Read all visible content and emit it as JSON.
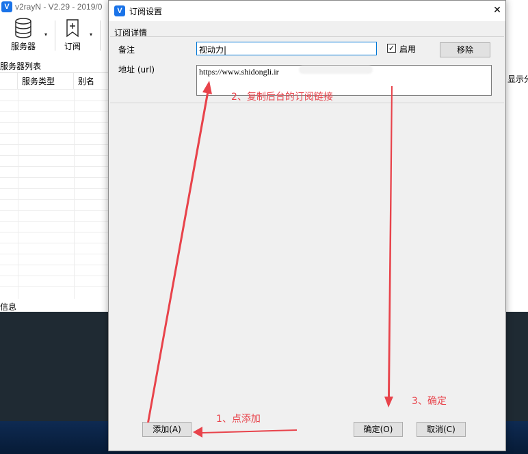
{
  "app": {
    "title": "v2rayN - V2.29 - 2019/0",
    "logo_glyph": "V"
  },
  "toolbar": {
    "servers_label": "服务器",
    "subscription_label": "订阅",
    "dropdown_glyph": "▾"
  },
  "server_list": {
    "title": "服务器列表",
    "columns": [
      "服务类型",
      "别名"
    ]
  },
  "info_panel": {
    "label": "信息"
  },
  "right_panel": {
    "label": "显示分"
  },
  "dialog": {
    "icon_glyph": "V",
    "title": "订阅设置",
    "close_glyph": "✕",
    "group_title": "订阅详情",
    "remark_label": "备注",
    "remark_value": "视动力|",
    "enable_checked_glyph": "✓",
    "enable_label": "启用",
    "remove_label": "移除",
    "url_label": "地址 (url)",
    "url_value": "https://www.shidongli.ir",
    "add_label": "添加(A)",
    "ok_label": "确定(O)",
    "cancel_label": "取消(C)"
  },
  "annotations": {
    "step1": "1、点添加",
    "step2": "2、复制后台的订阅链接",
    "step3": "3、确定",
    "color": "#e8434b"
  }
}
